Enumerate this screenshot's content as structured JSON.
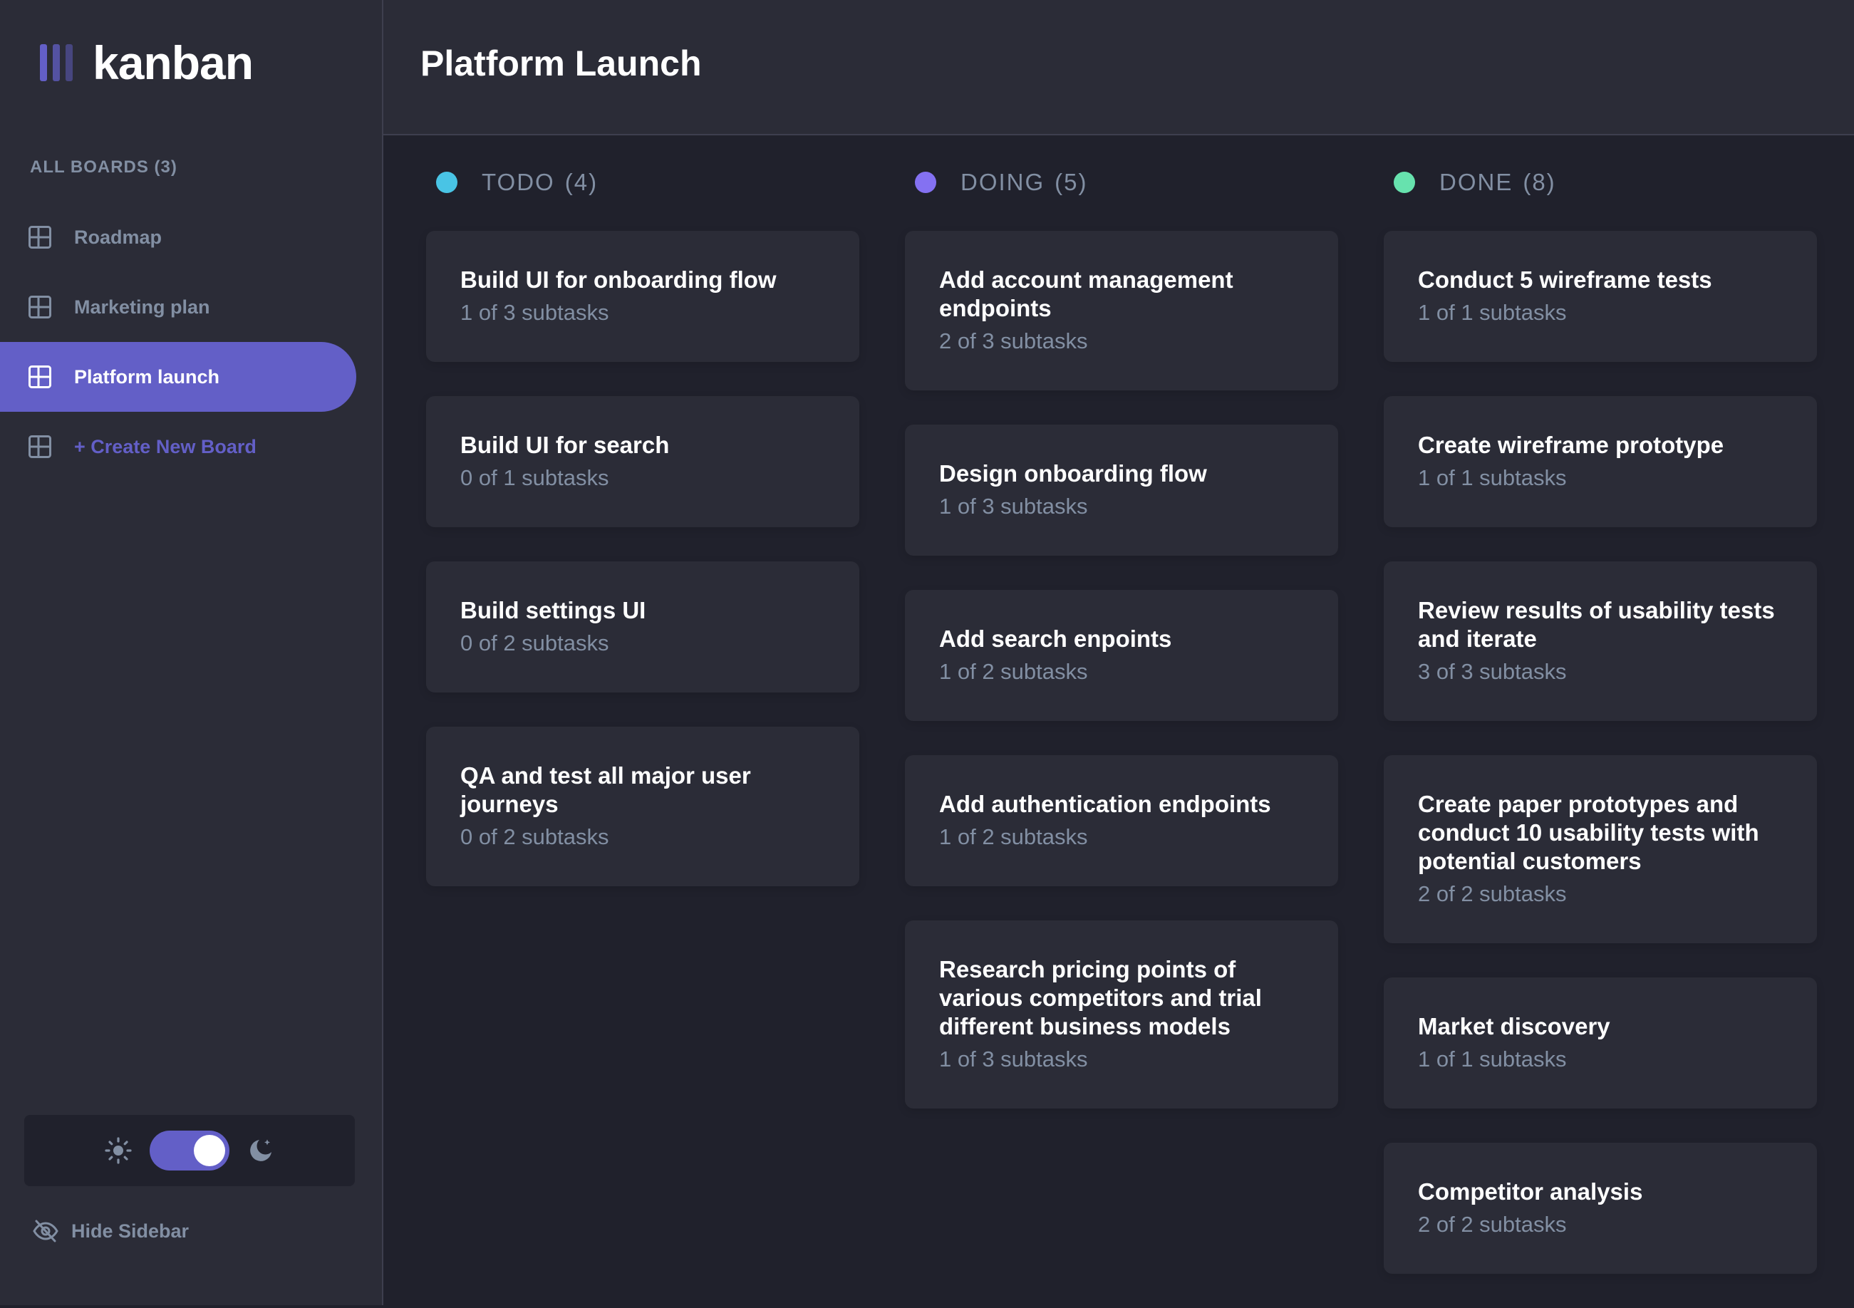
{
  "app": {
    "name": "kanban"
  },
  "sidebar": {
    "boards_heading": "ALL BOARDS (3)",
    "boards": [
      {
        "label": "Roadmap",
        "active": false
      },
      {
        "label": "Marketing plan",
        "active": false
      },
      {
        "label": "Platform launch",
        "active": true
      }
    ],
    "create_label": "+ Create New Board",
    "theme": {
      "mode": "dark",
      "light_icon": "sun-icon",
      "dark_icon": "moon-icon"
    },
    "hide_label": "Hide Sidebar"
  },
  "header": {
    "board_title": "Platform Launch"
  },
  "columns": [
    {
      "name": "TODO",
      "count": "(4)",
      "color": "#49c4e5",
      "cards": [
        {
          "title": "Build UI for onboarding flow",
          "subtasks": "1 of 3 subtasks"
        },
        {
          "title": "Build UI for search",
          "subtasks": "0 of 1 subtasks"
        },
        {
          "title": "Build settings UI",
          "subtasks": "0 of 2 subtasks"
        },
        {
          "title": "QA and test all major user journeys",
          "subtasks": "0 of 2 subtasks"
        }
      ]
    },
    {
      "name": "DOING",
      "count": "(5)",
      "color": "#8471f2",
      "cards": [
        {
          "title": "Add account management endpoints",
          "subtasks": "2 of 3 subtasks"
        },
        {
          "title": "Design onboarding flow",
          "subtasks": "1 of 3 subtasks"
        },
        {
          "title": "Add search enpoints",
          "subtasks": "1 of 2 subtasks"
        },
        {
          "title": "Add authentication endpoints",
          "subtasks": "1 of 2 subtasks"
        },
        {
          "title": "Research pricing points of various competitors and trial different business models",
          "subtasks": "1 of 3 subtasks"
        }
      ]
    },
    {
      "name": "DONE",
      "count": "(8)",
      "color": "#67e2ae",
      "cards": [
        {
          "title": "Conduct 5 wireframe tests",
          "subtasks": "1 of 1 subtasks"
        },
        {
          "title": "Create wireframe prototype",
          "subtasks": "1 of 1 subtasks"
        },
        {
          "title": "Review results of usability tests and iterate",
          "subtasks": "3 of 3 subtasks"
        },
        {
          "title": "Create paper prototypes and conduct 10 usability tests with potential customers",
          "subtasks": "2 of 2 subtasks"
        },
        {
          "title": "Market discovery",
          "subtasks": "1 of 1 subtasks"
        },
        {
          "title": "Competitor analysis",
          "subtasks": "2 of 2 subtasks"
        }
      ]
    }
  ]
}
